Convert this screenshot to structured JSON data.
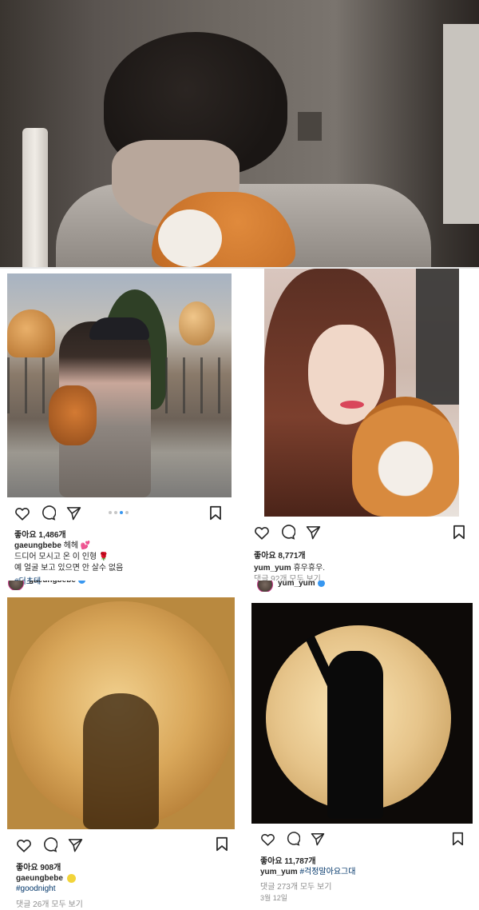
{
  "post1": {
    "likes": "좋아요 1,486개",
    "username": "gaeungbebe",
    "caption_line1": "헤헤",
    "caption_line2": "드디어 모시고 온 이 인형",
    "caption_line3": "예 얼굴 보고 있으면 안 살수 없음",
    "hashtag": "#더초테",
    "carousel_dots": 4,
    "carousel_active": 3
  },
  "post2": {
    "likes": "좋아요 8,771개",
    "username": "yum_yum",
    "caption": "휴우휴우.",
    "comments": "댓글 92개 모두 보기"
  },
  "post3": {
    "header_username": "gaeungbebe",
    "likes": "좋아요 908개",
    "username": "gaeungbebe",
    "hashtag": "#goodnight",
    "comments": "댓글 26개 모두 보기"
  },
  "post4": {
    "header_username": "yum_yum",
    "likes": "좋아요 11,787개",
    "username": "yum_yum",
    "hashtag": "#걱정말아요그대",
    "comments": "댓글 273개 모두 보기",
    "date": "3월 12일"
  },
  "icons": [
    "heart-icon",
    "comment-icon",
    "share-icon",
    "bookmark-icon"
  ],
  "colors": {
    "link": "#003569",
    "muted": "#8e8e8e",
    "text": "#262626",
    "carousel_active": "#3897f0"
  }
}
